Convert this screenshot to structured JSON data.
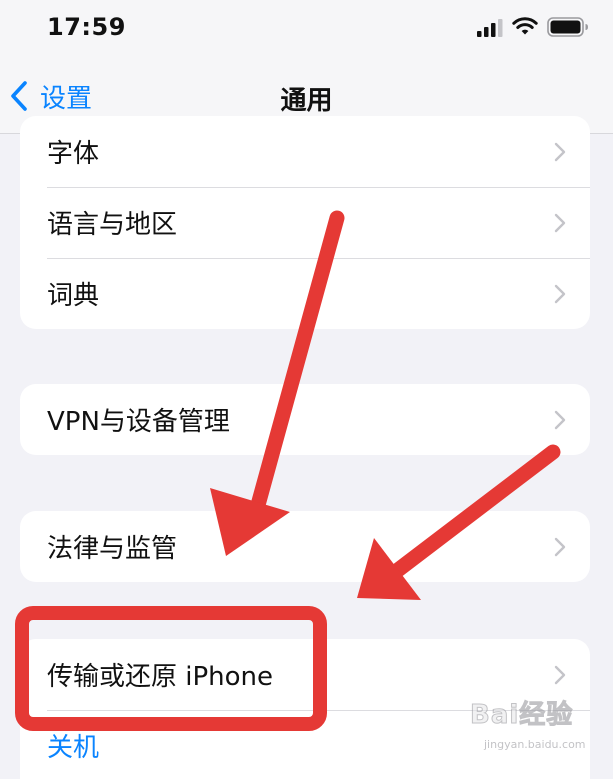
{
  "status_bar": {
    "time": "17:59"
  },
  "nav": {
    "back_label": "设置",
    "title": "通用"
  },
  "groups": [
    {
      "rows": [
        {
          "label": "字体"
        },
        {
          "label": "语言与地区"
        },
        {
          "label": "词典"
        }
      ]
    },
    {
      "rows": [
        {
          "label": "VPN与设备管理"
        }
      ]
    },
    {
      "rows": [
        {
          "label": "法律与监管"
        }
      ]
    },
    {
      "rows": [
        {
          "label": "传输或还原 iPhone"
        },
        {
          "label": "关机"
        }
      ]
    }
  ],
  "watermark": {
    "text": "Bai经验",
    "url": "jingyan.baidu.com"
  },
  "colors": {
    "accent": "#0a84ff",
    "annotation_red": "#e53935",
    "background": "#f2f2f7"
  },
  "icons": {
    "back": "chevron-left-icon",
    "disclosure": "chevron-right-icon",
    "signal": "cellular-signal-icon",
    "wifi": "wifi-icon",
    "battery": "battery-icon"
  }
}
